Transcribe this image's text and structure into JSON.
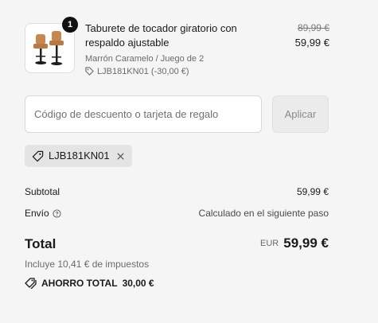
{
  "product": {
    "quantity": "1",
    "title": "Taburete de tocador giratorio con respaldo ajustable",
    "variant": "Marrón Caramelo / Juego de 2",
    "discount_code": "LJB181KN01 (-30,00 €)",
    "original_price": "89,99 €",
    "price": "59,99 €",
    "image_icon": "bar-stools-image"
  },
  "discount": {
    "placeholder": "Código de descuento o tarjeta de regalo",
    "value": "",
    "apply_label": "Aplicar",
    "applied_code": "LJB181KN01"
  },
  "summary": {
    "subtotal_label": "Subtotal",
    "subtotal_value": "59,99 €",
    "shipping_label": "Envío",
    "shipping_value": "Calculado en el siguiente paso",
    "total_label": "Total",
    "currency": "EUR",
    "total_value": "59,99 €",
    "taxes_note": "Incluye 10,41 € de impuestos",
    "savings_label": "AHORRO TOTAL",
    "savings_value": "30,00 €"
  },
  "colors": {
    "background": "#f5f5f5",
    "text": "#1a1a1a",
    "muted": "#6b6b6b",
    "chip": "#e4e4e4"
  }
}
